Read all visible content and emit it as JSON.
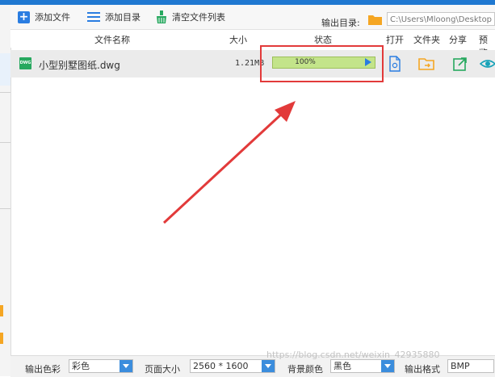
{
  "toolbar": {
    "add_file": "添加文件",
    "add_dir": "添加目录",
    "clear_list": "清空文件列表",
    "output_dir_label": "输出目录:",
    "output_dir_value": "C:\\Users\\Mloong\\Desktop"
  },
  "table": {
    "headers": {
      "name": "文件名称",
      "size": "大小",
      "status": "状态",
      "open": "打开",
      "folder": "文件夹",
      "share": "分享",
      "preview": "预览"
    },
    "rows": [
      {
        "icon_text": "DWG",
        "name": "小型别墅图纸.dwg",
        "size": "1.21MB",
        "progress_label": "100%",
        "progress": 1.0
      }
    ]
  },
  "bottom": {
    "color_label": "输出色彩",
    "color_value": "彩色",
    "page_size_label": "页面大小",
    "page_size_value": "2560 * 1600",
    "bg_label": "背景颜色",
    "bg_value": "黑色",
    "format_label": "输出格式",
    "format_value": "BMP"
  },
  "watermark": "https://blog.csdn.net/weixin_42935880",
  "colors": {
    "accent": "#2a7de1",
    "highlight": "#e23a3a",
    "progress_fill": "#c3e48a",
    "folder": "#f5a623",
    "share": "#27a85f",
    "preview": "#17a2b8"
  }
}
